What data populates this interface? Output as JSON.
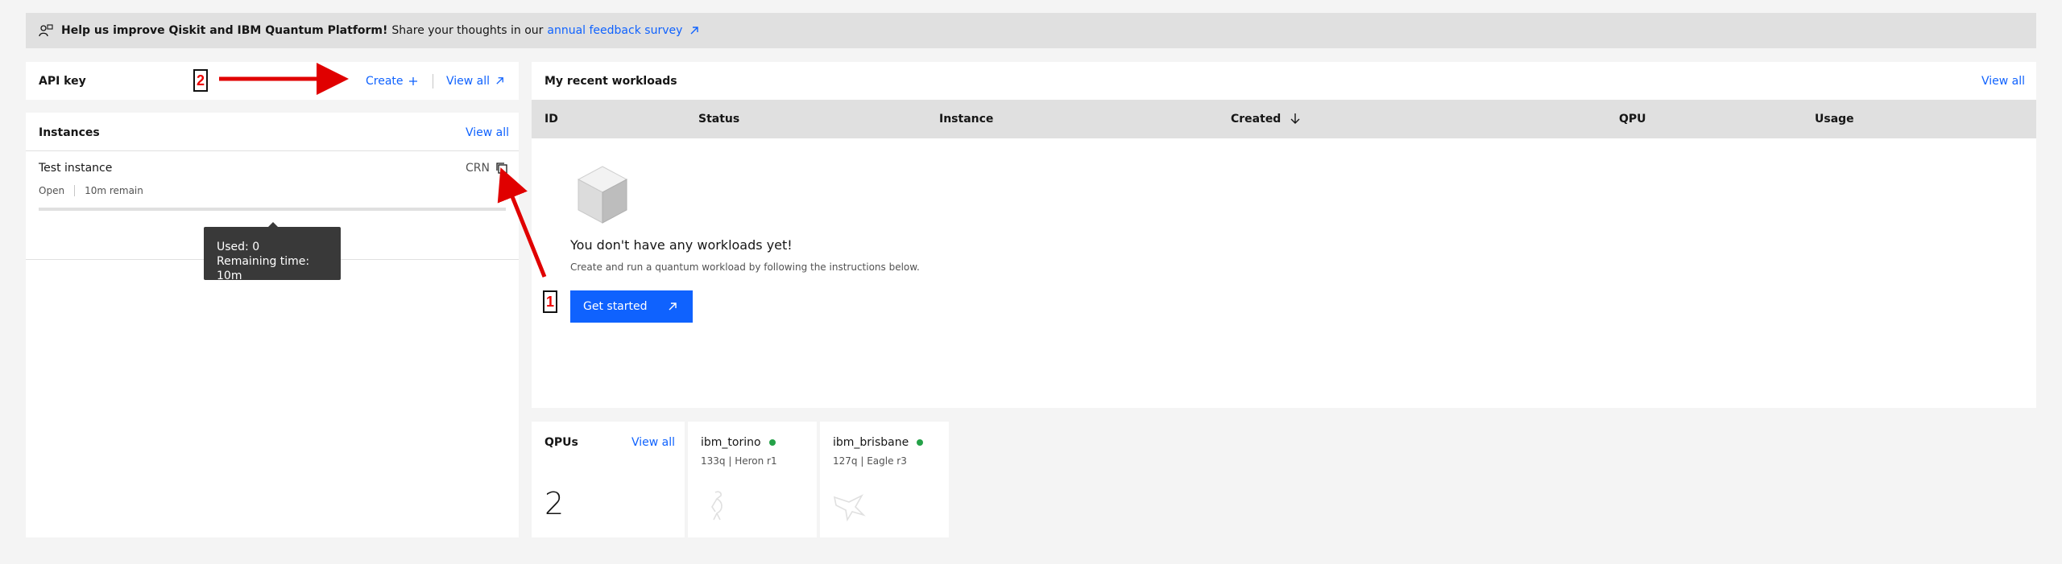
{
  "banner": {
    "bold_text": "Help us improve Qiskit and IBM Quantum Platform!",
    "text": "Share your thoughts in our",
    "link_text": "annual feedback survey",
    "icon": "feedback-icon"
  },
  "api_key": {
    "title": "API key",
    "create_label": "Create",
    "create_icon": "plus-icon",
    "view_all_label": "View all",
    "view_all_icon": "launch-icon"
  },
  "instances": {
    "title": "Instances",
    "view_all_label": "View all",
    "items": [
      {
        "name": "Test instance",
        "crn_label": "CRN",
        "status": "Open",
        "remaining": "10m remain",
        "usage_fraction": 0
      }
    ],
    "tooltip": {
      "used": "Used: 0",
      "remaining": "Remaining time: 10m"
    }
  },
  "workloads": {
    "title": "My recent workloads",
    "view_all_label": "View all",
    "columns": [
      "ID",
      "Status",
      "Instance",
      "Created",
      "QPU",
      "Usage"
    ],
    "sorted_column": "Created",
    "sort_direction": "descending",
    "empty_title": "You don't have any workloads yet!",
    "empty_description": "Create and run a quantum workload by following the instructions below.",
    "get_started_label": "Get started"
  },
  "qpus": {
    "title": "QPUs",
    "view_all_label": "View all",
    "count": "2",
    "items": [
      {
        "name": "ibm_torino",
        "spec": "133q | Heron r1",
        "status_color": "#24a148"
      },
      {
        "name": "ibm_brisbane",
        "spec": "127q | Eagle r3",
        "status_color": "#24a148"
      }
    ]
  },
  "annotations": {
    "badge_1": "1",
    "badge_2": "2",
    "arrow_color": "#e00000"
  },
  "colors": {
    "accent": "#0f62fe",
    "background": "#f4f4f4",
    "status_ok": "#24a148"
  }
}
